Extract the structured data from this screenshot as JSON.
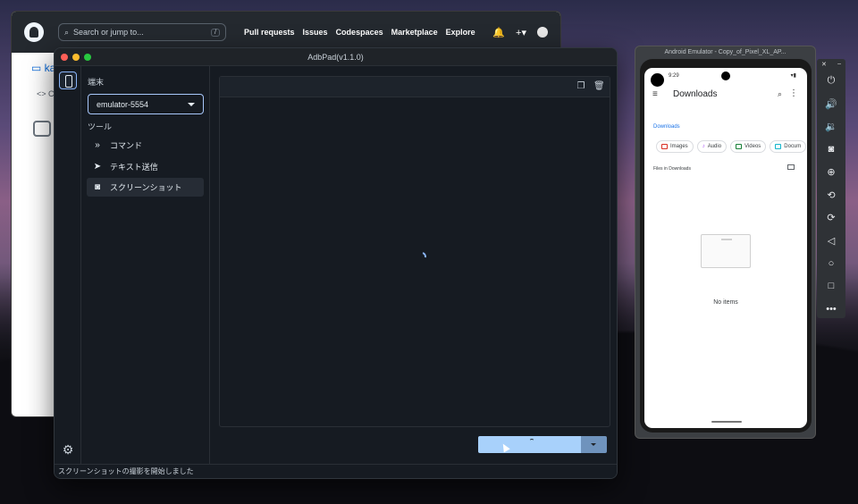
{
  "github": {
    "search_placeholder": "Search or jump to...",
    "search_shortcut": "/",
    "nav": [
      "Pull requests",
      "Issues",
      "Codespaces",
      "Marketplace",
      "Explore"
    ],
    "repo_owner_partial": "ka",
    "code_tab_partial": "C",
    "plus_label": "+▾"
  },
  "adbpad": {
    "title": "AdbPad(v1.1.0)",
    "device_section_label": "端末",
    "selected_device": "emulator-5554",
    "tools_section_label": "ツール",
    "tools": [
      {
        "label": "コマンド",
        "icon": "double-chevron-icon"
      },
      {
        "label": "テキスト送信",
        "icon": "send-icon"
      },
      {
        "label": "スクリーンショット",
        "icon": "camera-icon"
      }
    ],
    "active_tool": "スクリーンショット",
    "status_message": "スクリーンショットの撮影を開始しました",
    "colors": {
      "accent": "#a8c7fa",
      "button": "#a8d1fb",
      "background": "#161b22"
    }
  },
  "emulator": {
    "window_title": "Android Emulator - Copy_of_Pixel_XL_AP...",
    "time": "9:29",
    "app_title": "Downloads",
    "breadcrumb": "Downloads",
    "chips": [
      {
        "label": "Images",
        "color": "#d93025"
      },
      {
        "label": "Audio",
        "color": "#a142f4"
      },
      {
        "label": "Videos",
        "color": "#188038"
      },
      {
        "label": "Docum",
        "color": "#12b5cb"
      }
    ],
    "files_label": "Files in Downloads",
    "empty_message": "No items",
    "controls": [
      "power-icon",
      "volume-up-icon",
      "volume-down-icon",
      "camera-icon",
      "zoom-icon",
      "rotate-left-icon",
      "rotate-right-icon",
      "back-icon",
      "home-icon",
      "overview-icon",
      "more-icon"
    ]
  }
}
